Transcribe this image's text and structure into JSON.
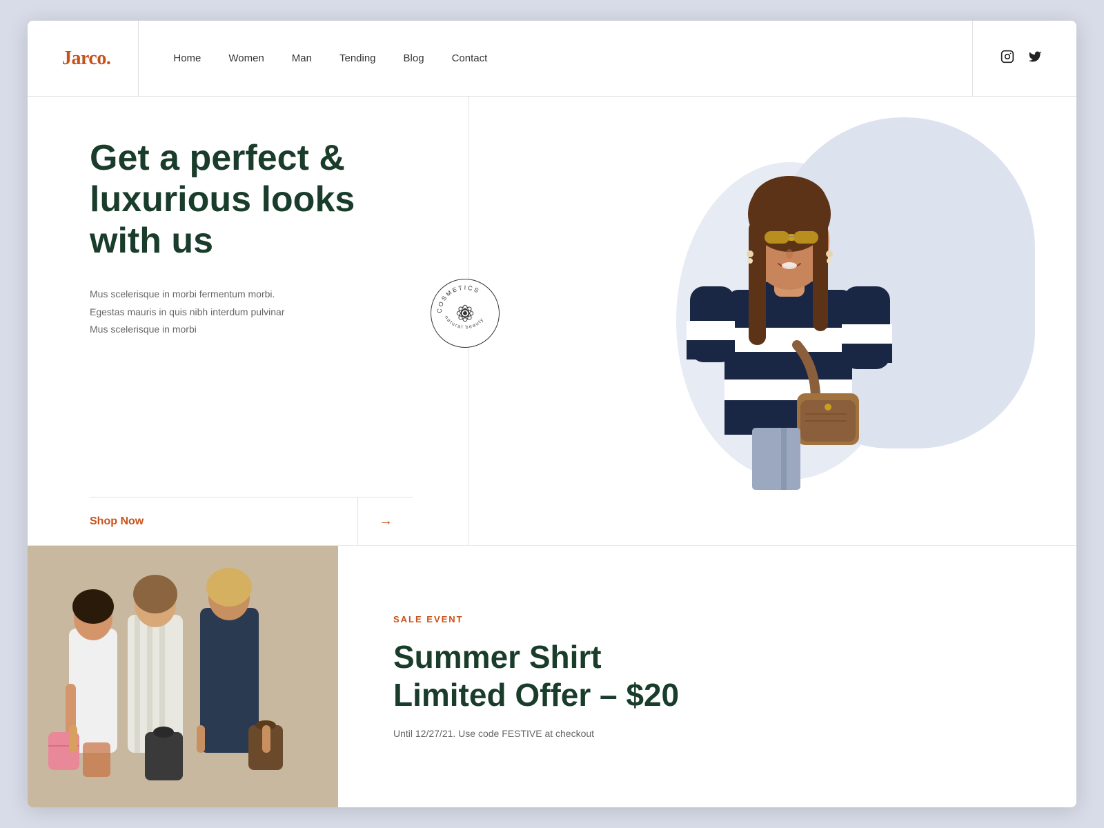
{
  "brand": {
    "logo": "Jarco."
  },
  "nav": {
    "items": [
      {
        "label": "Home",
        "id": "home"
      },
      {
        "label": "Women",
        "id": "women"
      },
      {
        "label": "Man",
        "id": "man"
      },
      {
        "label": "Tending",
        "id": "tending"
      },
      {
        "label": "Blog",
        "id": "blog"
      },
      {
        "label": "Contact",
        "id": "contact"
      }
    ]
  },
  "social": {
    "instagram_icon": "📷",
    "twitter_icon": "🐦"
  },
  "hero": {
    "headline": "Get a perfect & luxurious looks with us",
    "body": "Mus scelerisque in morbi fermentum morbi.\nEgestas mauris in quis nibh interdum pulvinar\nMus scelerisque in morbi",
    "badge_text": "COSMETICS natural beauty",
    "shop_now": "Shop Now",
    "arrow": "→"
  },
  "sale": {
    "label": "SALE EVENT",
    "headline": "Summer Shirt\nLimited Offer – $20",
    "body": "Until 12/27/21. Use code FESTIVE at checkout"
  },
  "colors": {
    "accent": "#c8521a",
    "dark_green": "#1a3d2b",
    "bg_blob": "#dde2ef"
  }
}
